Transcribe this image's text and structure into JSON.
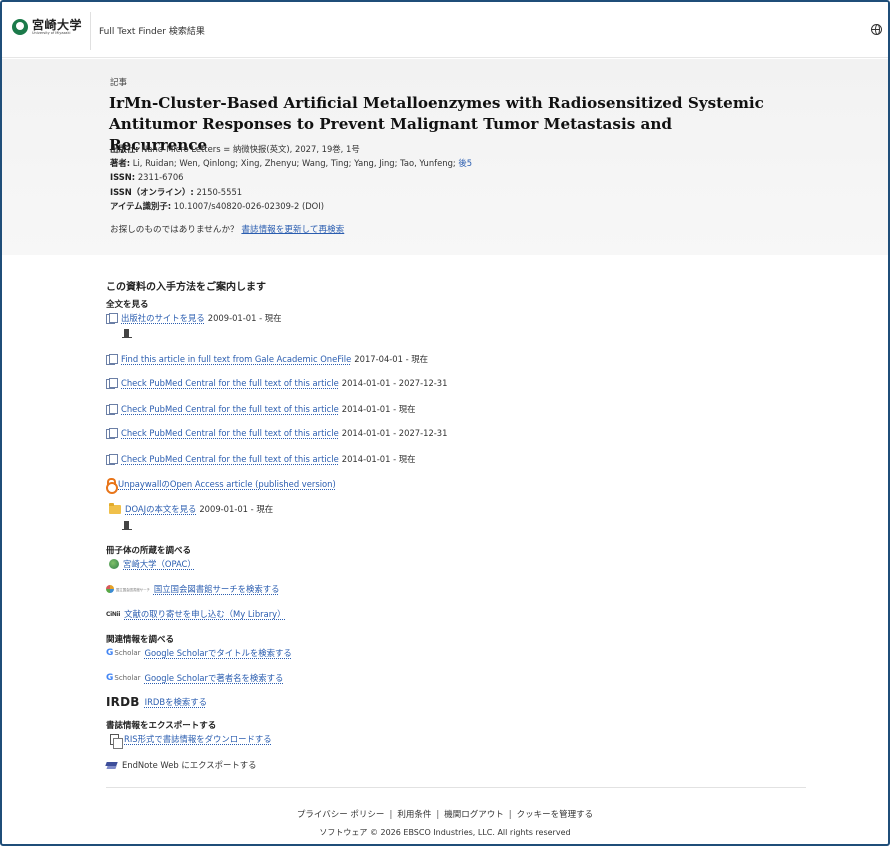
{
  "header": {
    "logo_jp": "宮崎大学",
    "logo_en": "University of Miyazaki",
    "app_title": "Full Text Finder 検索結果"
  },
  "record": {
    "kind": "記事",
    "title": "IrMn-Cluster-Based Artificial Metalloenzymes with Radiosensitized Systemic Antitumor Responses to Prevent Malignant Tumor Metastasis and Recurrence",
    "publisher_label": "出版社:",
    "publisher_value": " Nano-Micro Letters = 纳微快报(英文), 2027, 19巻, 1号",
    "authors_label": "著者:",
    "authors_value": " Li, Ruidan; Wen, Qinlong; Xing, Zhenyu; Wang, Ting; Yang, Jing; Tao, Yunfeng;",
    "authors_more": " 後5",
    "issn_label": "ISSN:",
    "issn_value": " 2311-6706",
    "eissn_label": "ISSN（オンライン）:",
    "eissn_value": " 2150-5551",
    "item_id_label": "アイテム識別子:",
    "item_id_value": " 10.1007/s40820-026-02309-2 (DOI)",
    "not_found_text": "お探しのものではありませんか？",
    "not_found_link": "書誌情報を更新して再検索"
  },
  "access": {
    "heading": "この資料の入手方法をご案内します",
    "fulltext_heading": "全文を見る",
    "fulltext": [
      {
        "label": "出版社のサイトを見る",
        "date": "2009-01-01 - 現在"
      },
      {
        "label": "Find this article in full text from Gale Academic OneFile",
        "date": "2017-04-01 - 現在"
      },
      {
        "label": "Check PubMed Central for the full text of this article",
        "date": "2014-01-01 - 2027-12-31"
      },
      {
        "label": "Check PubMed Central for the full text of this article",
        "date": "2014-01-01 - 現在"
      },
      {
        "label": "Check PubMed Central for the full text of this article",
        "date": "2014-01-01 - 2027-12-31"
      },
      {
        "label": "Check PubMed Central for the full text of this article",
        "date": "2014-01-01 - 現在"
      },
      {
        "label": "UnpaywallのOpen Access article (published version)",
        "date": ""
      },
      {
        "label": "DOAJの本文を見る",
        "date": "2009-01-01 - 現在"
      }
    ],
    "holdings_heading": "冊子体の所蔵を調べる",
    "holdings": [
      {
        "label": "宮崎大学（OPAC）"
      },
      {
        "label": "国立国会図書館サーチを検索する",
        "icon_text": "国立国会図書館サーチ"
      },
      {
        "label": "文献の取り寄せを申し込む（My Library）",
        "icon_text": "CiNii"
      }
    ],
    "related_heading": "関連情報を調べる",
    "related": [
      {
        "label": "Google Scholarでタイトルを検索する",
        "icon_g": "G",
        "icon_s": "Scholar"
      },
      {
        "label": "Google Scholarで著者名を検索する",
        "icon_g": "G",
        "icon_s": "Scholar"
      },
      {
        "label": "IRDBを検索する",
        "icon_text": "IRDB"
      }
    ],
    "export_heading": "書誌情報をエクスポートする",
    "export": [
      {
        "label": "RIS形式で書誌情報をダウンロードする"
      },
      {
        "label": "EndNote Web にエクスポートする"
      }
    ]
  },
  "footer": {
    "links": [
      "プライバシー ポリシー",
      "利用条件",
      "機関ログアウト",
      "クッキーを管理する"
    ],
    "copyright": "ソフトウェア © 2026 EBSCO Industries, LLC. All rights reserved"
  }
}
